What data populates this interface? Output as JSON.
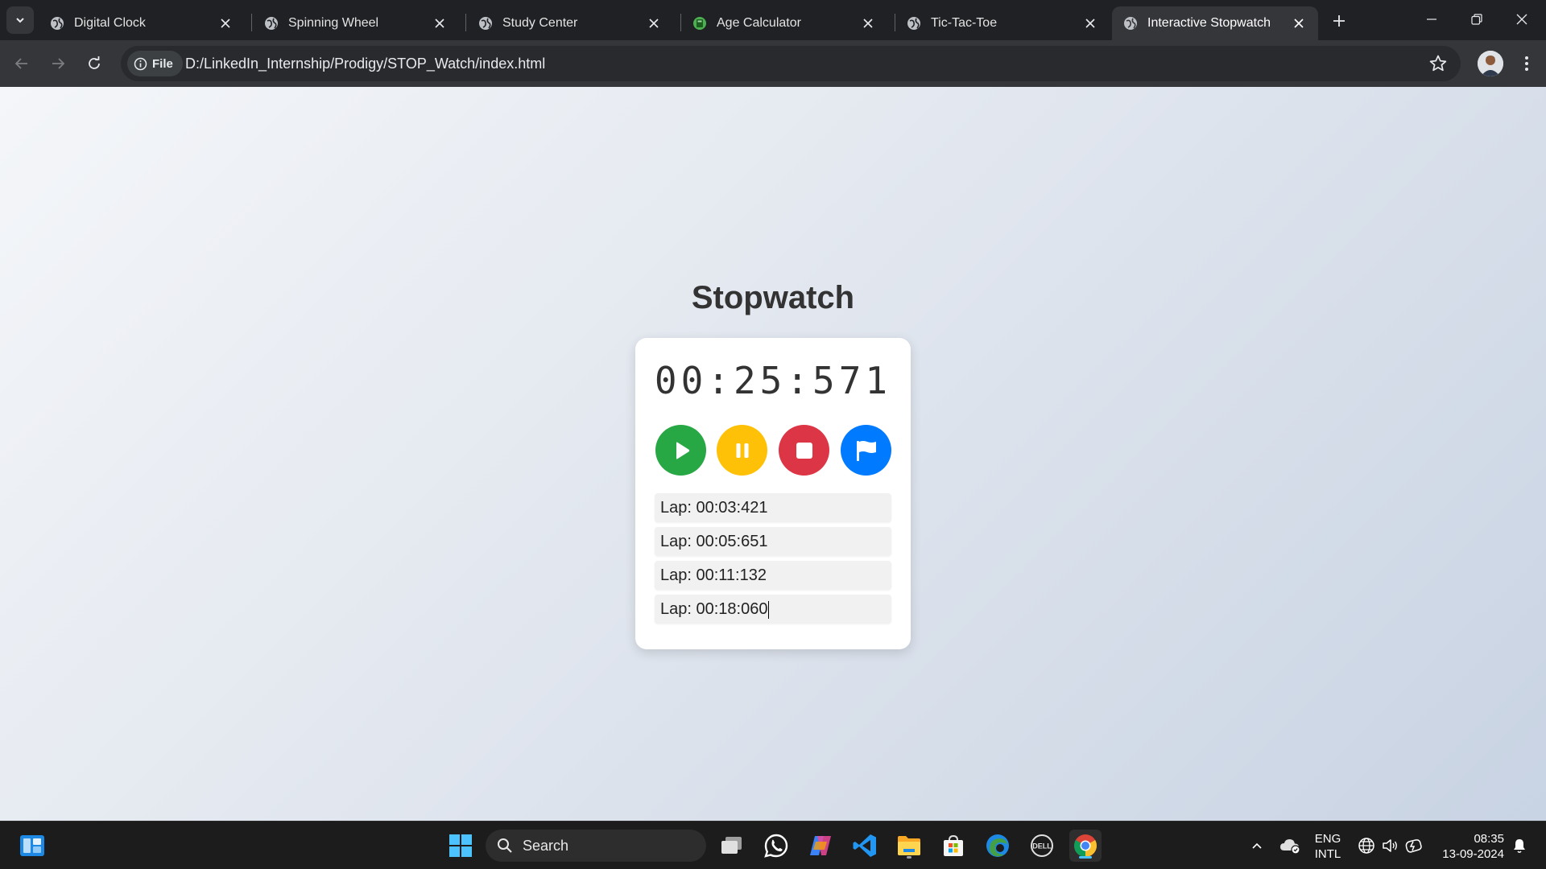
{
  "browser": {
    "tabs": [
      {
        "label": "Digital Clock",
        "icon": "globe-icon"
      },
      {
        "label": "Spinning Wheel",
        "icon": "globe-icon"
      },
      {
        "label": "Study Center",
        "icon": "globe-icon"
      },
      {
        "label": "Age Calculator",
        "icon": "green-app-icon"
      },
      {
        "label": "Tic-Tac-Toe",
        "icon": "globe-icon"
      },
      {
        "label": "Interactive Stopwatch",
        "icon": "globe-icon",
        "active": true
      }
    ],
    "address": {
      "chip_label": "File",
      "url": "D:/LinkedIn_Internship/Prodigy/STOP_Watch/index.html"
    }
  },
  "page": {
    "title": "Stopwatch",
    "time_display": "00:25:571",
    "controls": [
      {
        "name": "start",
        "color": "#28a745",
        "icon": "play-icon"
      },
      {
        "name": "pause",
        "color": "#ffc107",
        "icon": "pause-icon"
      },
      {
        "name": "stop",
        "color": "#dc3545",
        "icon": "stop-icon"
      },
      {
        "name": "lap",
        "color": "#007bff",
        "icon": "flag-icon"
      }
    ],
    "laps": [
      "Lap: 00:03:421",
      "Lap: 00:05:651",
      "Lap: 00:11:132",
      "Lap: 00:18:060"
    ]
  },
  "taskbar": {
    "search_label": "Search",
    "language": "ENG",
    "layout": "INTL",
    "time": "08:35",
    "date": "13-09-2024"
  }
}
